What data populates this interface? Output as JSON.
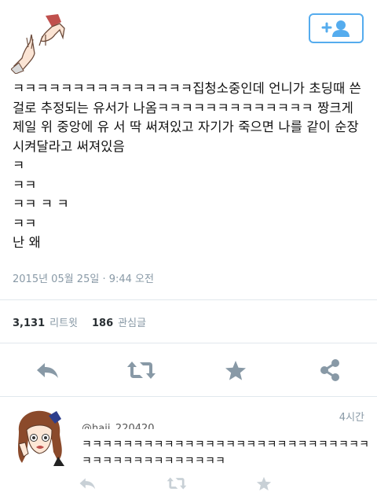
{
  "tweet": {
    "text": "ㅋㅋㅋㅋㅋㅋㅋㅋㅋㅋㅋㅋㅋㅋㅋ집청소중인데 언니가 초딩때 쓴걸로 추정되는 유서가 나옴ㅋㅋㅋㅋㅋㅋㅋㅋㅋㅋㅋㅋㅋ 짱크게 제일 위 중앙에 유 서 딱 써져있고 자기가 죽으면 나를 같이 순장시켜달라고 써져있음\nㅋ\nㅋㅋ\nㅋㅋ ㅋ ㅋ\nㅋㅋ\n난 왜",
    "timestamp": "2015년 05월 25일 · 9:44 오전",
    "retweet_count": "3,131",
    "retweet_label": "리트윗",
    "like_count": "186",
    "like_label": "관심글"
  },
  "follow_button": {
    "icon": "follow-user-icon",
    "color": "#55acee"
  },
  "actions": [
    "reply-icon",
    "retweet-icon",
    "favorite-icon",
    "share-icon"
  ],
  "reply": {
    "handle": "@haji_220420",
    "time": "4시간",
    "text": "ㅋㅋㅋㅋㅋㅋㅋㅋㅋㅋㅋㅋㅋㅋㅋㅋㅋㅋㅋㅋㅋㅋㅋㅋㅋㅋㅋㅋㅋㅋㅋㅋㅋㅋㅋㅋㅋㅋㅋㅋㅋㅋ"
  },
  "colors": {
    "icon": "#8899a6",
    "icon_light": "#c8d0d6",
    "accent": "#55acee"
  }
}
